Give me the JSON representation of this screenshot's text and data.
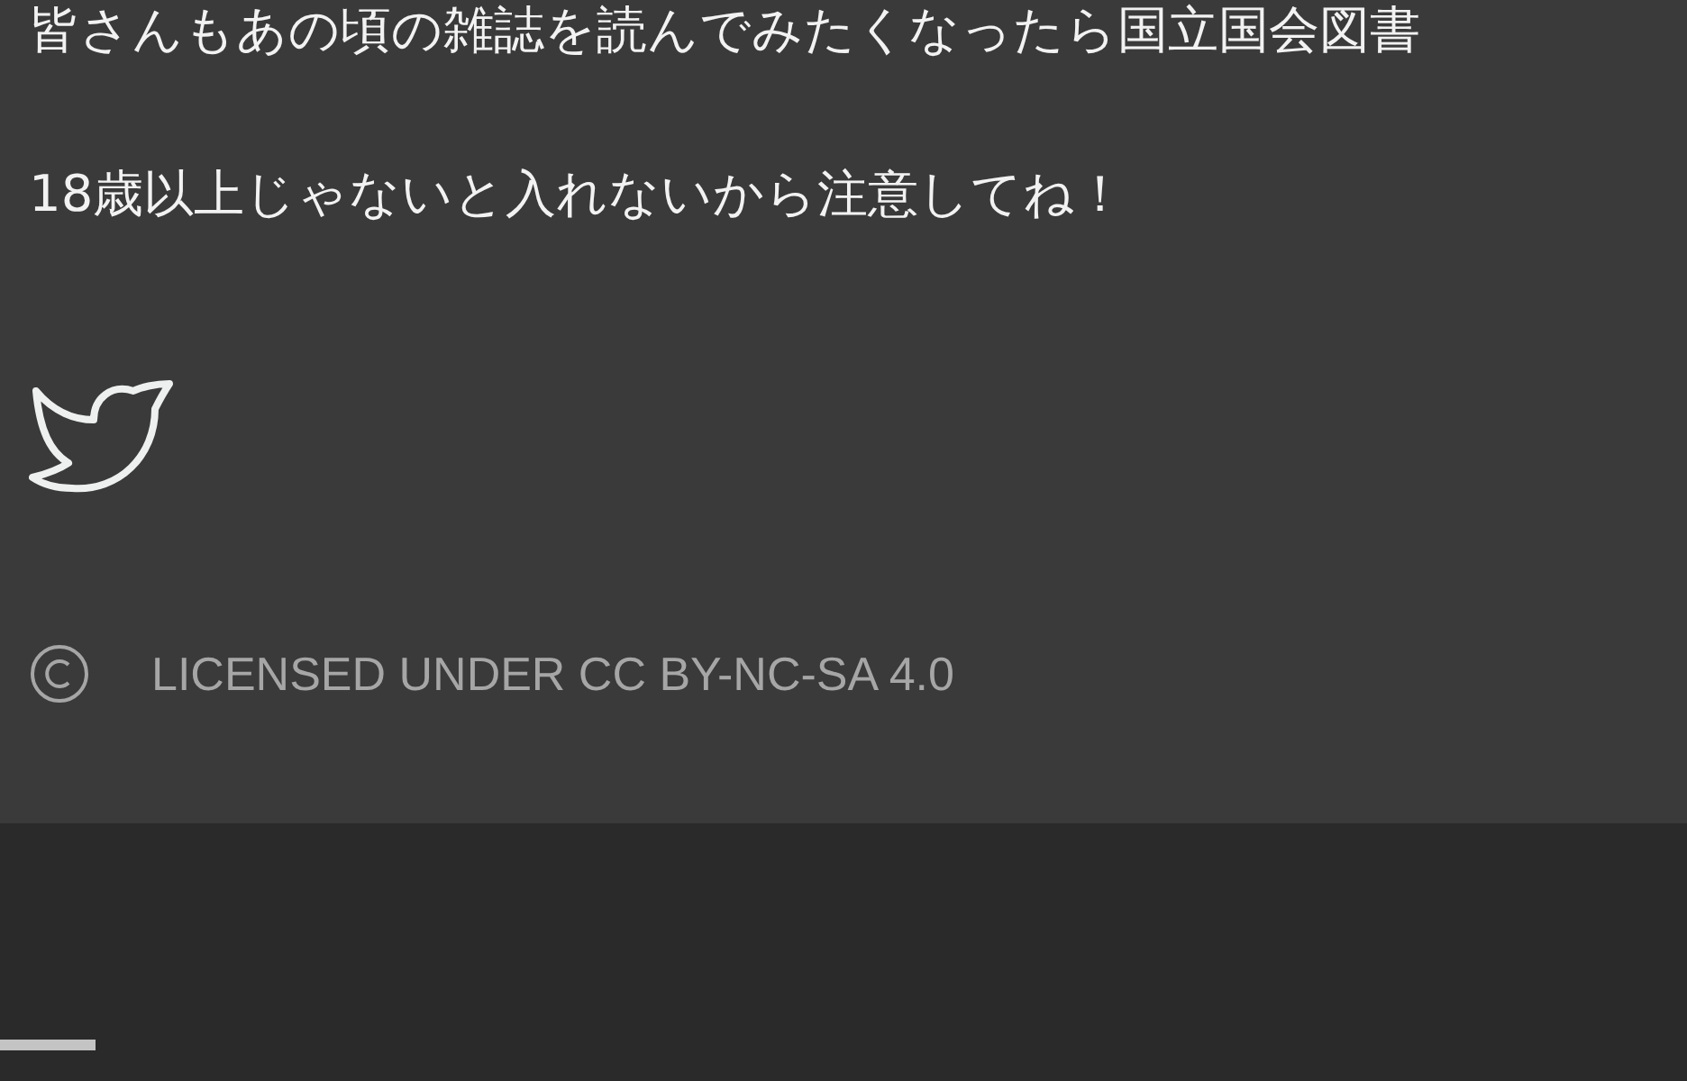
{
  "article": {
    "paragraphs": [
      "皆さんもあの頃の雑誌を読んでみたくなったら国立国会図書",
      "18歳以上じゃないと入れないから注意してね！"
    ]
  },
  "social": {
    "links": [
      {
        "kind": "twitter"
      }
    ]
  },
  "license": {
    "text": "LICENSED UNDER CC BY-NC-SA 4.0"
  },
  "reading_progress": {
    "level": 0.057
  }
}
